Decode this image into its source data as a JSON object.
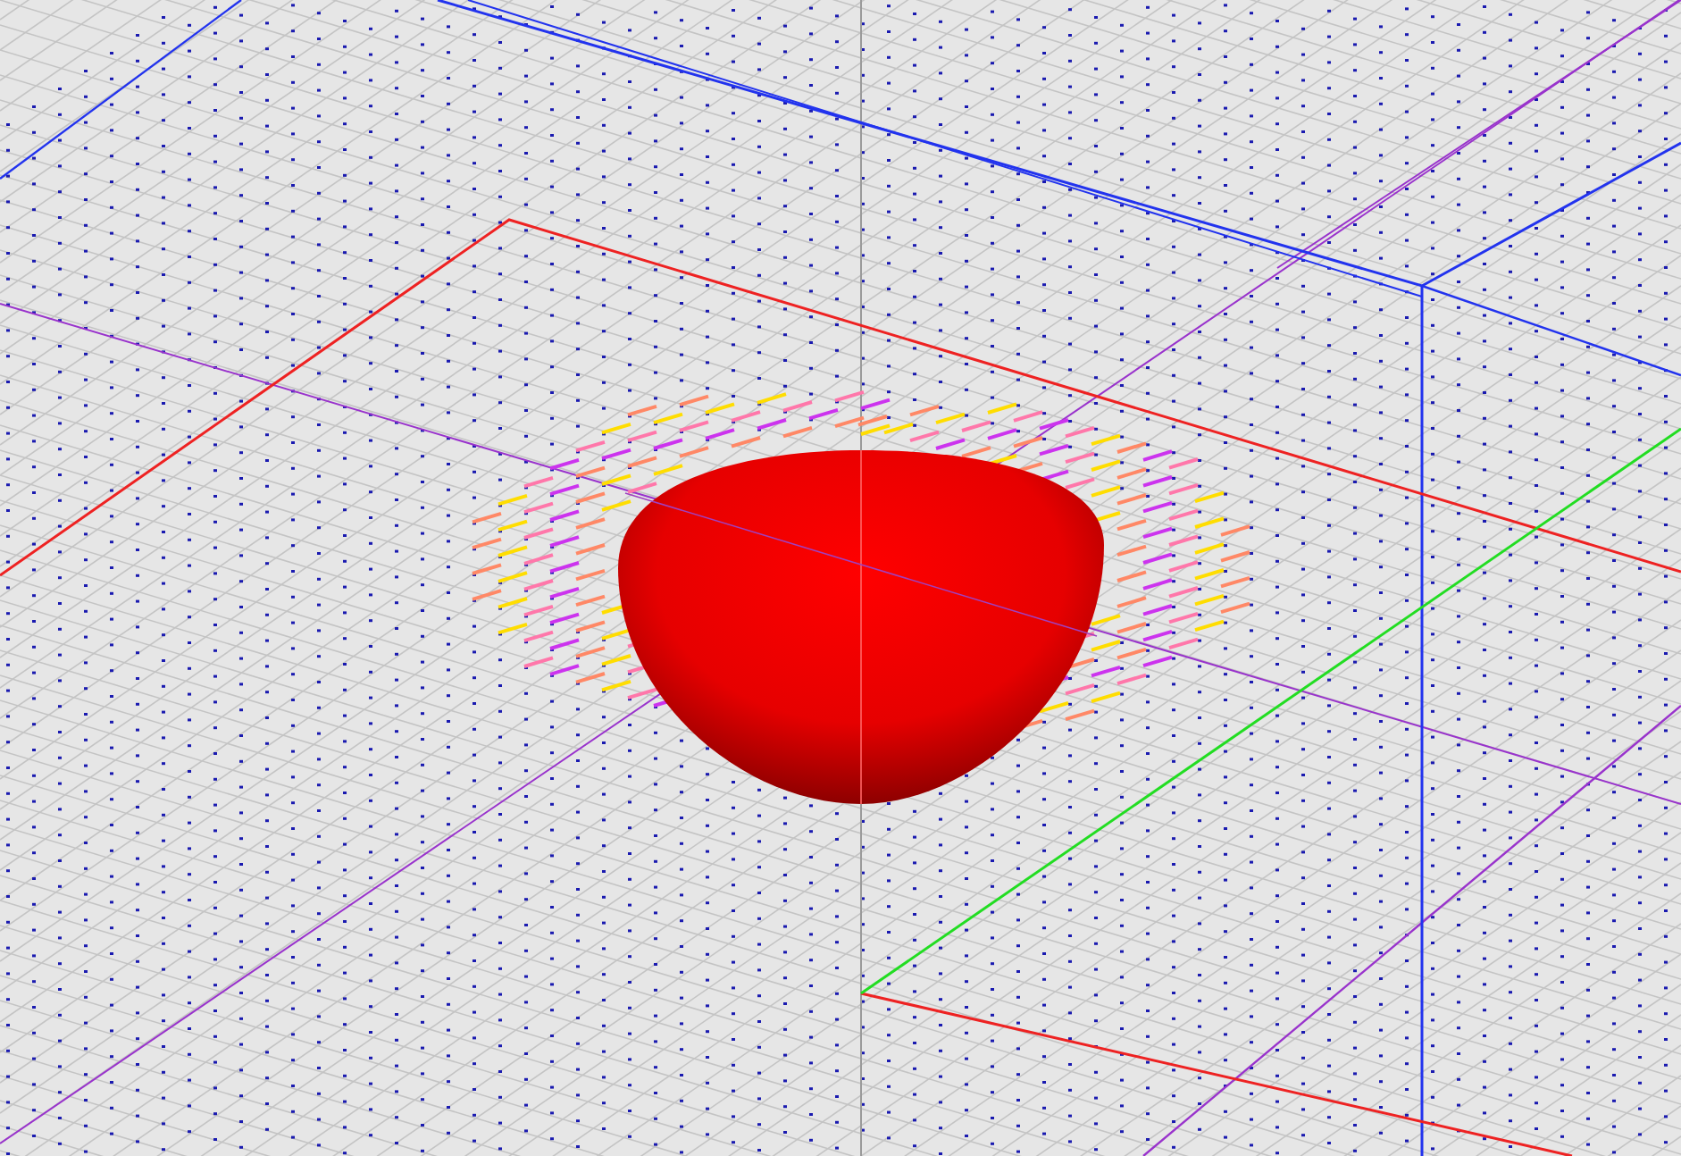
{
  "scene": {
    "kind": "vector-field-3d"
  }
}
